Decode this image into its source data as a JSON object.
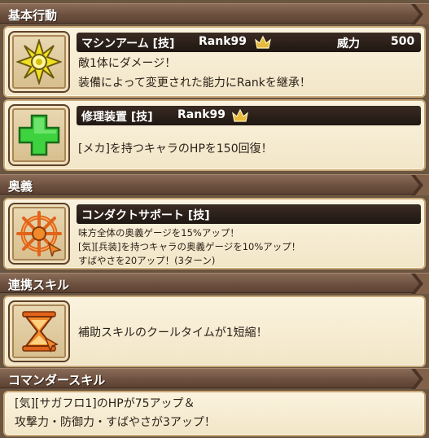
{
  "sections": {
    "basic": "基本行動",
    "ougi": "奥義",
    "renkei": "連携スキル",
    "commander": "コマンダースキル"
  },
  "skills": {
    "machine_arm": {
      "name": "マシンアーム [技]",
      "rank": "Rank99",
      "power_label": "威力",
      "power_value": "500",
      "lines": [
        "敵1体にダメージ！",
        "装備によって変更された能力にRankを継承！"
      ]
    },
    "repair": {
      "name": "修理装置 [技]",
      "rank": "Rank99",
      "line": "[メカ]を持つキャラのHPを150回復！"
    },
    "conduct": {
      "name": "コンダクトサポート [技]",
      "lines": [
        "味方全体の奥義ゲージを15%アップ！",
        "[気][兵装]を持つキャラの奥義ゲージを10%アップ！",
        "すばやさを20アップ！(3ターン)"
      ]
    },
    "link": {
      "line": "補助スキルのクールタイムが1短縮！"
    },
    "commander": {
      "lines": [
        "[気][サガフロ1]のHPが75アップ＆",
        "攻撃力・防御力・すばやさが3アップ！"
      ]
    }
  },
  "colors": {
    "header_bg": "#6e5140",
    "card_bg": "#f6ebd0",
    "title_bar": "#2a1f18",
    "crown": "#e8b93a"
  },
  "icons": {
    "machine_arm": "spiky-burst-icon",
    "repair": "green-cross-icon",
    "conduct": "orange-wheel-icon",
    "link": "hourglass-cursor-icon",
    "crown": "crown-icon"
  }
}
